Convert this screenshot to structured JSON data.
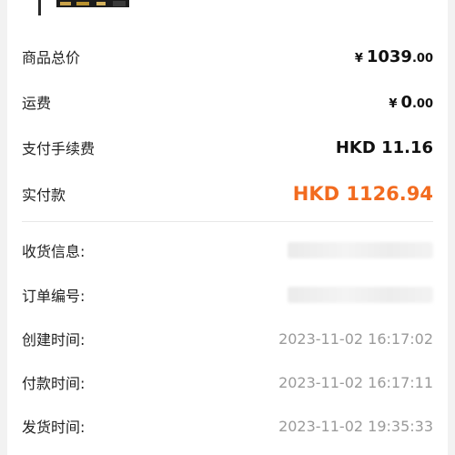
{
  "product_image": {
    "alt_icon": "product-thumbnail"
  },
  "summary": {
    "goods_total_label": "商品总价",
    "goods_total_symbol": "¥",
    "goods_total_int": "1039",
    "goods_total_dec": ".00",
    "shipping_label": "运费",
    "shipping_symbol": "¥",
    "shipping_int": "0",
    "shipping_dec": ".00",
    "fee_label": "支付手续费",
    "fee_value": "HKD 11.16",
    "paid_label": "实付款",
    "paid_value": "HKD 1126.94"
  },
  "order_info": {
    "receiver_label": "收货信息:",
    "order_no_label": "订单编号:",
    "created_label": "创建时间:",
    "created_value": "2023-11-02 16:17:02",
    "paid_time_label": "付款时间:",
    "paid_time_value": "2023-11-02 16:17:11",
    "shipped_label": "发货时间:",
    "shipped_value": "2023-11-02 19:35:33"
  },
  "colors": {
    "accent": "#f26b1f",
    "muted": "#9a9a9a",
    "background": "#f2f2f2"
  }
}
